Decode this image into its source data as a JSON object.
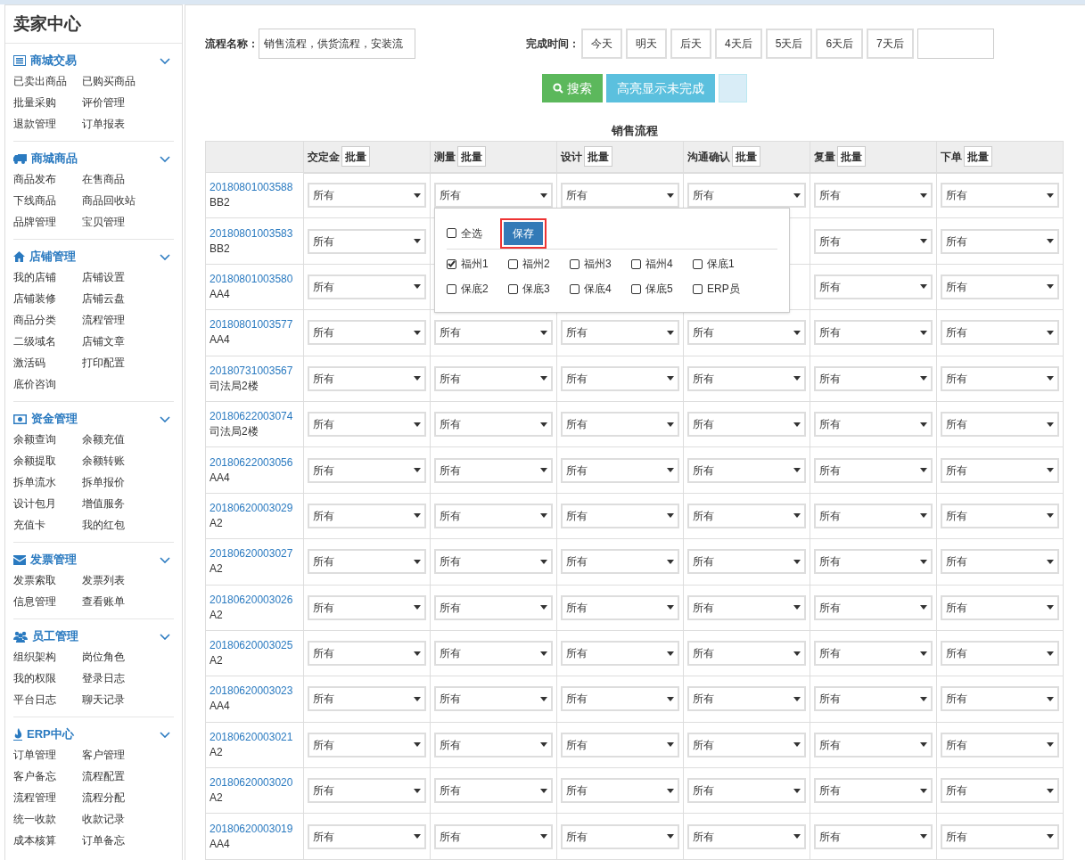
{
  "sidebar": {
    "title": "卖家中心",
    "sections": [
      {
        "title": "商城交易",
        "items": [
          "已卖出商品",
          "已购买商品",
          "批量采购",
          "评价管理",
          "退款管理",
          "订单报表"
        ]
      },
      {
        "title": "商城商品",
        "items": [
          "商品发布",
          "在售商品",
          "下线商品",
          "商品回收站",
          "品牌管理",
          "宝贝管理"
        ]
      },
      {
        "title": "店铺管理",
        "items": [
          "我的店铺",
          "店铺设置",
          "店铺装修",
          "店铺云盘",
          "商品分类",
          "流程管理",
          "二级域名",
          "店铺文章",
          "激活码",
          "打印配置",
          "底价咨询"
        ]
      },
      {
        "title": "资金管理",
        "items": [
          "余额查询",
          "余额充值",
          "余额提取",
          "余额转账",
          "拆单流水",
          "拆单报价",
          "设计包月",
          "增值服务",
          "充值卡",
          "我的红包"
        ]
      },
      {
        "title": "发票管理",
        "items": [
          "发票索取",
          "发票列表",
          "信息管理",
          "查看账单"
        ]
      },
      {
        "title": "员工管理",
        "items": [
          "组织架构",
          "岗位角色",
          "我的权限",
          "登录日志",
          "平台日志",
          "聊天记录"
        ]
      },
      {
        "title": "ERP中心",
        "items": [
          "订单管理",
          "客户管理",
          "客户备忘",
          "流程配置",
          "流程管理",
          "流程分配",
          "统一收款",
          "收款记录",
          "成本核算",
          "订单备忘"
        ]
      }
    ]
  },
  "filters": {
    "name_label": "流程名称：",
    "name_value": "销售流程，供货流程，安装流",
    "time_label": "完成时间：",
    "time_buttons": [
      "今天",
      "明天",
      "后天",
      "4天后",
      "5天后",
      "6天后",
      "7天后"
    ]
  },
  "actions": {
    "search": "搜索",
    "highlight": "高亮显示未完成"
  },
  "table": {
    "caption": "销售流程",
    "columns": [
      {
        "label": "交定金",
        "batch": "批量"
      },
      {
        "label": "测量",
        "batch": "批量"
      },
      {
        "label": "设计",
        "batch": "批量"
      },
      {
        "label": "沟通确认",
        "batch": "批量"
      },
      {
        "label": "复量",
        "batch": "批量"
      },
      {
        "label": "下单",
        "batch": "批量"
      }
    ],
    "rows": [
      {
        "id": "20180801003588",
        "sub": "BB2",
        "cells": [
          "所有",
          "所有",
          "所有",
          "所有",
          "所有",
          "所有"
        ]
      },
      {
        "id": "20180801003583",
        "sub": "BB2",
        "cells": [
          "所有",
          null,
          null,
          null,
          "所有",
          "所有"
        ]
      },
      {
        "id": "20180801003580",
        "sub": "AA4",
        "cells": [
          "所有",
          null,
          null,
          null,
          "所有",
          "所有"
        ]
      },
      {
        "id": "20180801003577",
        "sub": "AA4",
        "cells": [
          "所有",
          "所有",
          "所有",
          "所有",
          "所有",
          "所有"
        ]
      },
      {
        "id": "20180731003567",
        "sub": "司法局2楼",
        "cells": [
          "所有",
          "所有",
          "所有",
          "所有",
          "所有",
          "所有"
        ]
      },
      {
        "id": "20180622003074",
        "sub": "司法局2楼",
        "cells": [
          "所有",
          "所有",
          "所有",
          "所有",
          "所有",
          "所有"
        ]
      },
      {
        "id": "20180622003056",
        "sub": "AA4",
        "cells": [
          "所有",
          "所有",
          "所有",
          "所有",
          "所有",
          "所有"
        ]
      },
      {
        "id": "20180620003029",
        "sub": "A2",
        "cells": [
          "所有",
          "所有",
          "所有",
          "所有",
          "所有",
          "所有"
        ]
      },
      {
        "id": "20180620003027",
        "sub": "A2",
        "cells": [
          "所有",
          "所有",
          "所有",
          "所有",
          "所有",
          "所有"
        ]
      },
      {
        "id": "20180620003026",
        "sub": "A2",
        "cells": [
          "所有",
          "所有",
          "所有",
          "所有",
          "所有",
          "所有"
        ]
      },
      {
        "id": "20180620003025",
        "sub": "A2",
        "cells": [
          "所有",
          "所有",
          "所有",
          "所有",
          "所有",
          "所有"
        ]
      },
      {
        "id": "20180620003023",
        "sub": "AA4",
        "cells": [
          "所有",
          "所有",
          "所有",
          "所有",
          "所有",
          "所有"
        ]
      },
      {
        "id": "20180620003021",
        "sub": "A2",
        "cells": [
          "所有",
          "所有",
          "所有",
          "所有",
          "所有",
          "所有"
        ]
      },
      {
        "id": "20180620003020",
        "sub": "A2",
        "cells": [
          "所有",
          "所有",
          "所有",
          "所有",
          "所有",
          "所有"
        ]
      },
      {
        "id": "20180620003019",
        "sub": "AA4",
        "cells": [
          "所有",
          "所有",
          "所有",
          "所有",
          "所有",
          "所有"
        ]
      }
    ]
  },
  "popup": {
    "select_all": {
      "label": "全选",
      "checked": false
    },
    "save": "保存",
    "options": [
      {
        "label": "福州1",
        "checked": true
      },
      {
        "label": "福州2",
        "checked": false
      },
      {
        "label": "福州3",
        "checked": false
      },
      {
        "label": "福州4",
        "checked": false
      },
      {
        "label": "保底1",
        "checked": false
      },
      {
        "label": "保底2",
        "checked": false
      },
      {
        "label": "保底3",
        "checked": false
      },
      {
        "label": "保底4",
        "checked": false
      },
      {
        "label": "保底5",
        "checked": false
      },
      {
        "label": "ERP员",
        "checked": false
      }
    ]
  }
}
